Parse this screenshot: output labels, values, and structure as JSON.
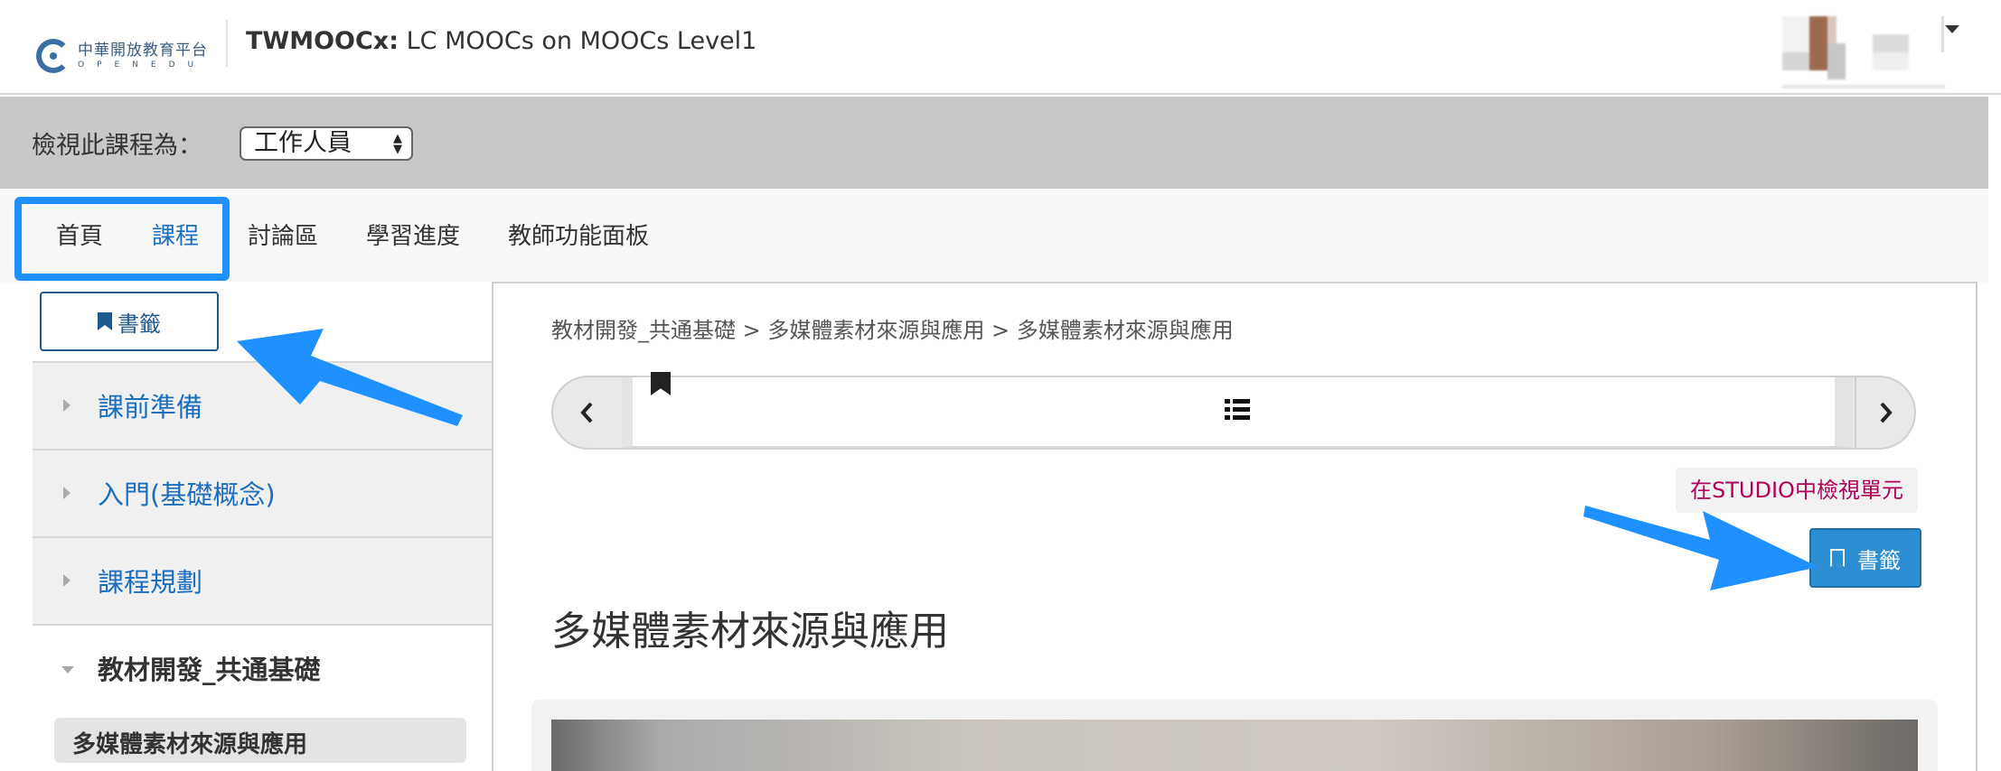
{
  "header": {
    "logo_cn": "中華開放教育平台",
    "logo_en": "OPENEDU",
    "course_org": "TWMOOCx:",
    "course_name": "LC MOOCs on MOOCs Level1"
  },
  "view_as": {
    "label": "檢視此課程為：",
    "selected": "工作人員"
  },
  "tabs": [
    {
      "label": "首頁"
    },
    {
      "label": "課程"
    },
    {
      "label": "討論區"
    },
    {
      "label": "學習進度"
    },
    {
      "label": "教師功能面板"
    }
  ],
  "sidebar": {
    "bookmarks_label": "書籤",
    "sections": [
      {
        "label": "課前準備"
      },
      {
        "label": "入門(基礎概念)"
      },
      {
        "label": "課程規劃"
      },
      {
        "label": "教材開發_共通基礎"
      }
    ],
    "subsection": "多媒體素材來源與應用"
  },
  "main": {
    "breadcrumb": "教材開發_共通基礎 > 多媒體素材來源與應用 > 多媒體素材來源與應用",
    "prev_symbol": "‹",
    "next_symbol": "›",
    "studio_link": "在STUDIO中檢視單元",
    "bookmark_label": "書籤",
    "unit_title": "多媒體素材來源與應用"
  },
  "colors": {
    "link_blue": "#1a6ebf",
    "highlight_blue": "#1e90ff",
    "studio_pink": "#b0005a",
    "bookmark_button": "#2c8fd4"
  }
}
